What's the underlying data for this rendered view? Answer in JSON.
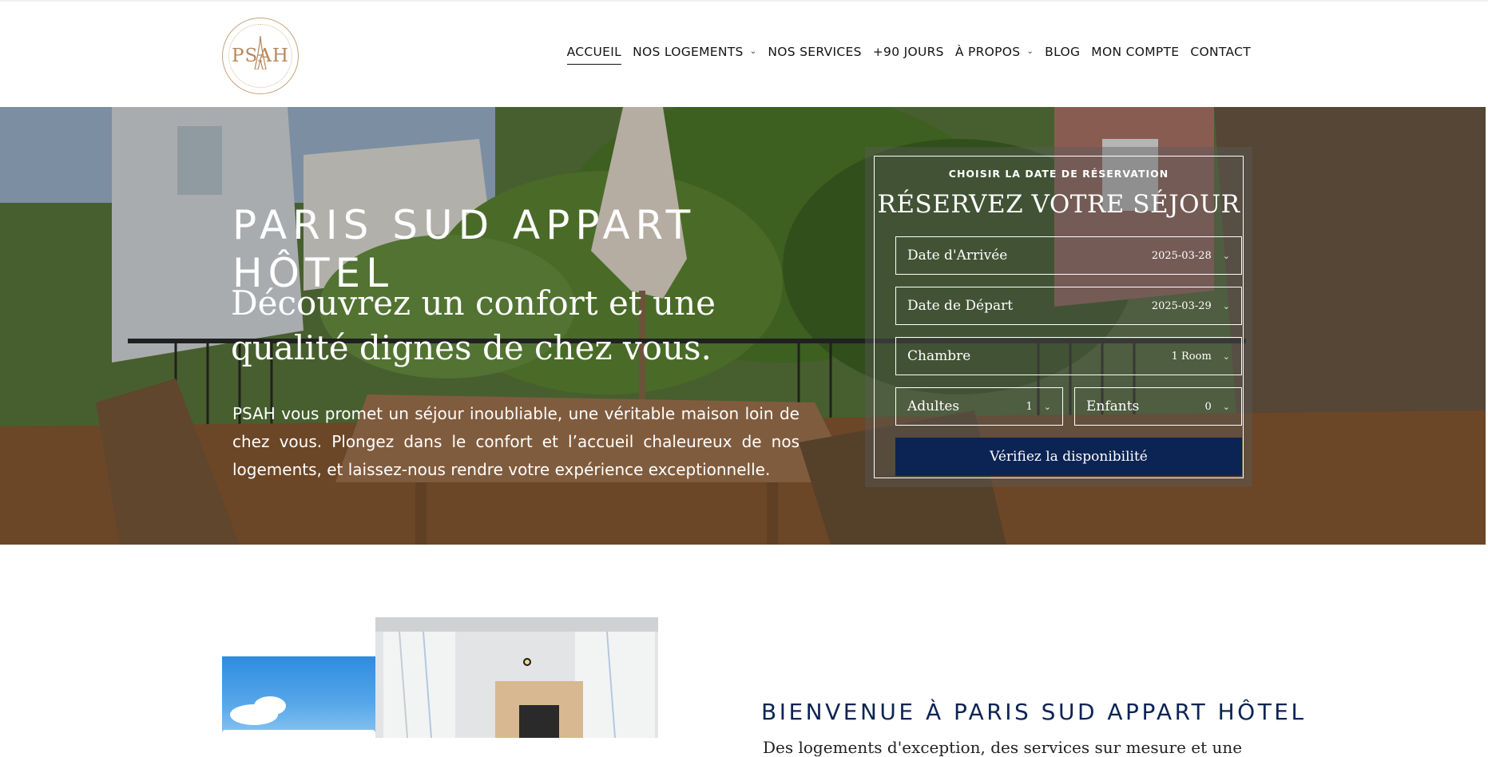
{
  "brand": {
    "logo_text": "PSAH"
  },
  "nav": {
    "items": [
      {
        "label": "ACCUEIL",
        "dropdown": false,
        "active": true
      },
      {
        "label": "NOS LOGEMENTS",
        "dropdown": true,
        "active": false
      },
      {
        "label": "NOS SERVICES",
        "dropdown": false,
        "active": false
      },
      {
        "label": "+90 JOURS",
        "dropdown": false,
        "active": false
      },
      {
        "label": "À PROPOS",
        "dropdown": true,
        "active": false
      },
      {
        "label": "BLOG",
        "dropdown": false,
        "active": false
      },
      {
        "label": "MON COMPTE",
        "dropdown": false,
        "active": false
      },
      {
        "label": "CONTACT",
        "dropdown": false,
        "active": false
      }
    ]
  },
  "hero": {
    "title": "PARIS SUD APPART HÔTEL",
    "subtitle": "Découvrez un confort et une qualité dignes de chez vous.",
    "paragraph": "PSAH vous promet un séjour inoubliable, une véritable maison loin de chez vous. Plongez dans le confort et l’accueil chaleureux de nos logements, et laissez-nous rendre votre expérience exceptionnelle."
  },
  "booking": {
    "label": "CHOISIR LA DATE DE RÉSERVATION",
    "title": "RÉSERVEZ VOTRE SÉJOUR",
    "arrival": {
      "label": "Date d'Arrivée",
      "value": "2025-03-28"
    },
    "departure": {
      "label": "Date de Départ",
      "value": "2025-03-29"
    },
    "room": {
      "label": "Chambre",
      "value": "1 Room"
    },
    "adults": {
      "label": "Adultes",
      "value": "1"
    },
    "children": {
      "label": "Enfants",
      "value": "0"
    },
    "submit_label": "Vérifiez la disponibilité"
  },
  "welcome": {
    "title": "BIENVENUE À PARIS SUD APPART HÔTEL",
    "text": "Des logements d'exception, des services sur mesure et une"
  },
  "colors": {
    "navy": "#0c2453",
    "gold": "#b8875a"
  },
  "icons": {
    "dropdown": "chevron-down-icon"
  }
}
